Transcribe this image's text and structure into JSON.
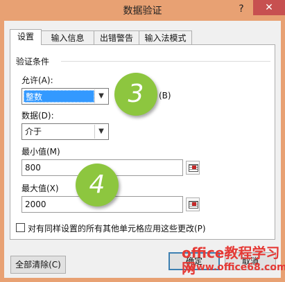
{
  "window": {
    "title": "数据验证",
    "help": "?",
    "close": "✕"
  },
  "tabs": [
    "设置",
    "输入信息",
    "出错警告",
    "输入法模式"
  ],
  "settings": {
    "group_label": "验证条件",
    "allow_label": "允许(A):",
    "allow_value": "整数",
    "ignore_blank_partial": "(B)",
    "data_label": "数据(D):",
    "data_value": "介于",
    "min_label": "最小值(M)",
    "min_value": "800",
    "max_label": "最大值(X)",
    "max_value": "2000",
    "apply_all_label": "对有同样设置的所有其他单元格应用这些更改(P)"
  },
  "buttons": {
    "clear_all": "全部清除(C)",
    "ok": "确定",
    "cancel": "取消"
  },
  "callouts": [
    "3",
    "4"
  ],
  "watermark": {
    "line1": "office教程学习网",
    "line2": "www.office68.com"
  },
  "colors": {
    "titlebar": "#e8a173",
    "close": "#c75050",
    "callout": "#8dc63f",
    "selection": "#3399ff",
    "watermark": "#e53935"
  }
}
